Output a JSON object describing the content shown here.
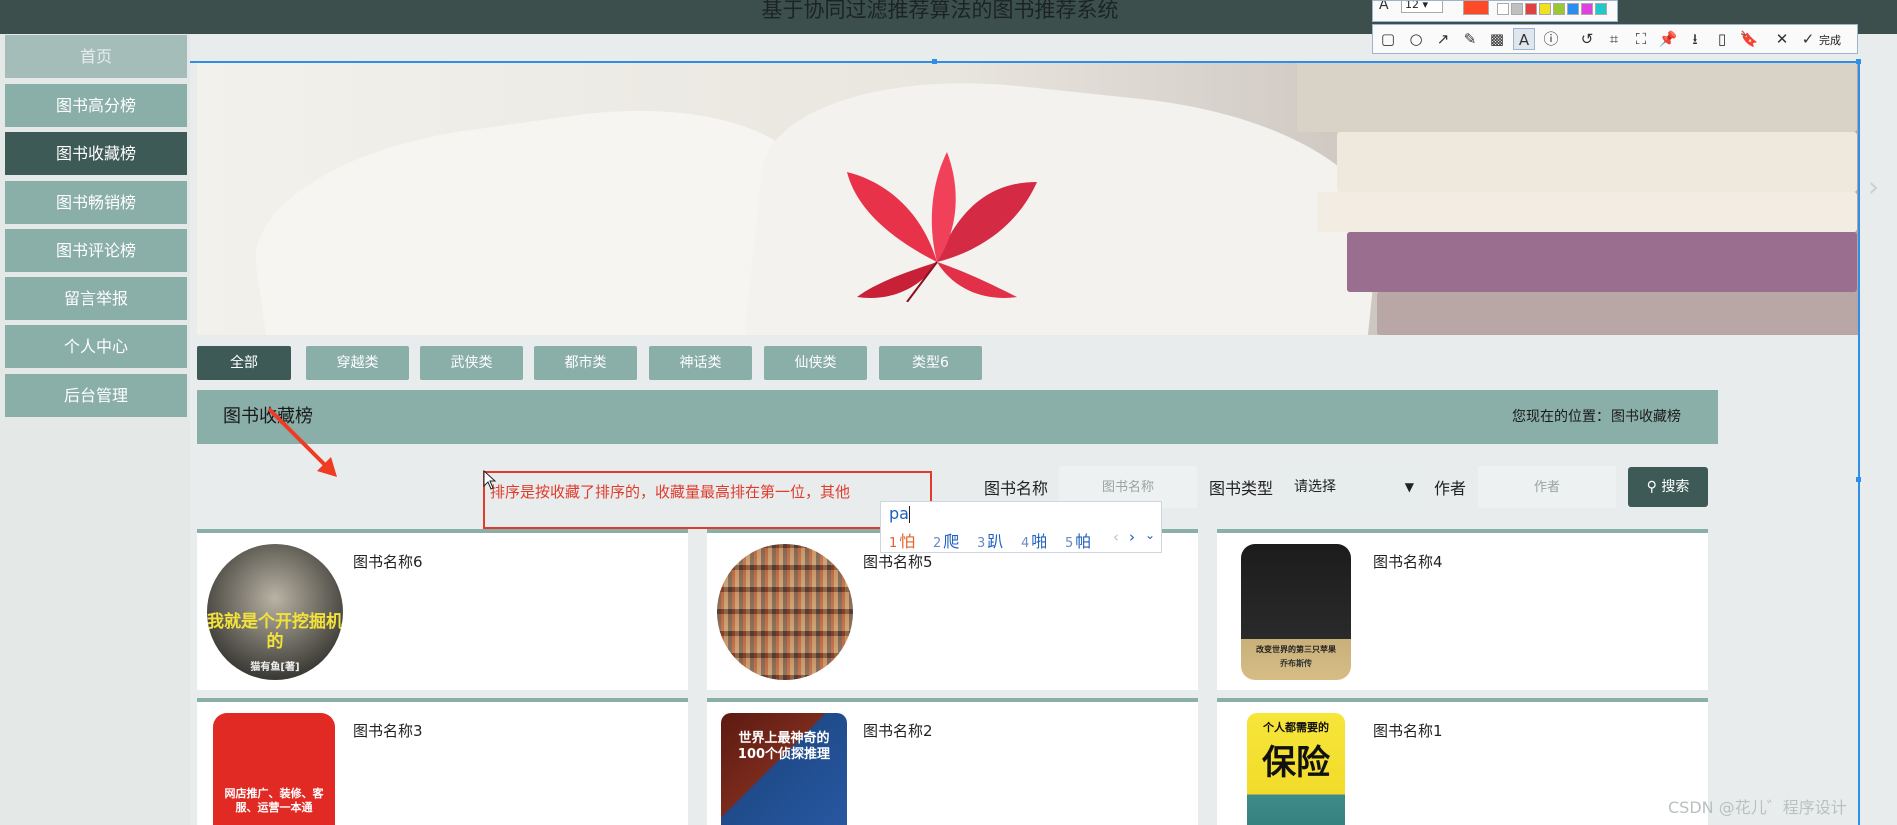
{
  "header": {
    "title": "基于协同过滤推荐算法的图书推荐系统"
  },
  "sidebar": {
    "items": [
      {
        "label": "首页"
      },
      {
        "label": "图书高分榜"
      },
      {
        "label": "图书收藏榜",
        "active": true
      },
      {
        "label": "图书畅销榜"
      },
      {
        "label": "图书评论榜"
      },
      {
        "label": "留言举报"
      },
      {
        "label": "个人中心"
      },
      {
        "label": "后台管理"
      }
    ]
  },
  "categories": [
    "全部",
    "穿越类",
    "武侠类",
    "都市类",
    "神话类",
    "仙侠类",
    "类型6"
  ],
  "panel": {
    "title": "图书收藏榜",
    "breadcrumb_prefix": "您现在的位置：",
    "breadcrumb_current": "图书收藏榜"
  },
  "annotation": {
    "note": "排序是按收藏了排序的，收藏量最高排在第一位，其他"
  },
  "search": {
    "name_label": "图书名称",
    "name_placeholder": "图书名称",
    "type_label": "图书类型",
    "type_value": "请选择",
    "author_label": "作者",
    "author_placeholder": "作者",
    "button_label": "搜索"
  },
  "ime": {
    "input": "pa",
    "candidates": [
      {
        "num": "1",
        "char": "怕"
      },
      {
        "num": "2",
        "char": "爬"
      },
      {
        "num": "3",
        "char": "趴"
      },
      {
        "num": "4",
        "char": "啪"
      },
      {
        "num": "5",
        "char": "帕"
      }
    ]
  },
  "books": [
    {
      "title": "图书名称6",
      "cover_text": "我就是个开挖掘机的",
      "cover_author": "猫有鱼[著]"
    },
    {
      "title": "图书名称5"
    },
    {
      "title": "图书名称4",
      "cover_text": "改变世界的第三只苹果",
      "cover_sub": "乔布斯传"
    },
    {
      "title": "图书名称3",
      "cover_text": "网店推广、装修、客服、运营一本通"
    },
    {
      "title": "图书名称2",
      "cover_text": "世界上最神奇的100个侦探推理"
    },
    {
      "title": "图书名称1",
      "cover_text": "保险",
      "cover_sub": "个人都需要的"
    }
  ],
  "capture_tool": {
    "font_size": "12",
    "done_label": "完成",
    "palette": [
      "#ffffff",
      "#c0c0c0",
      "#e04040",
      "#f0e020",
      "#9ac830",
      "#2a8df0",
      "#e040e0",
      "#20c8c8"
    ],
    "accent_color": "#ff4a2a"
  },
  "colors": {
    "sage": "#8aaea8",
    "dark_sage": "#3d5a56",
    "annotation_red": "#e03b2b",
    "selection_blue": "#2f8fe6"
  },
  "watermark": "CSDN @花儿゛程序设计"
}
